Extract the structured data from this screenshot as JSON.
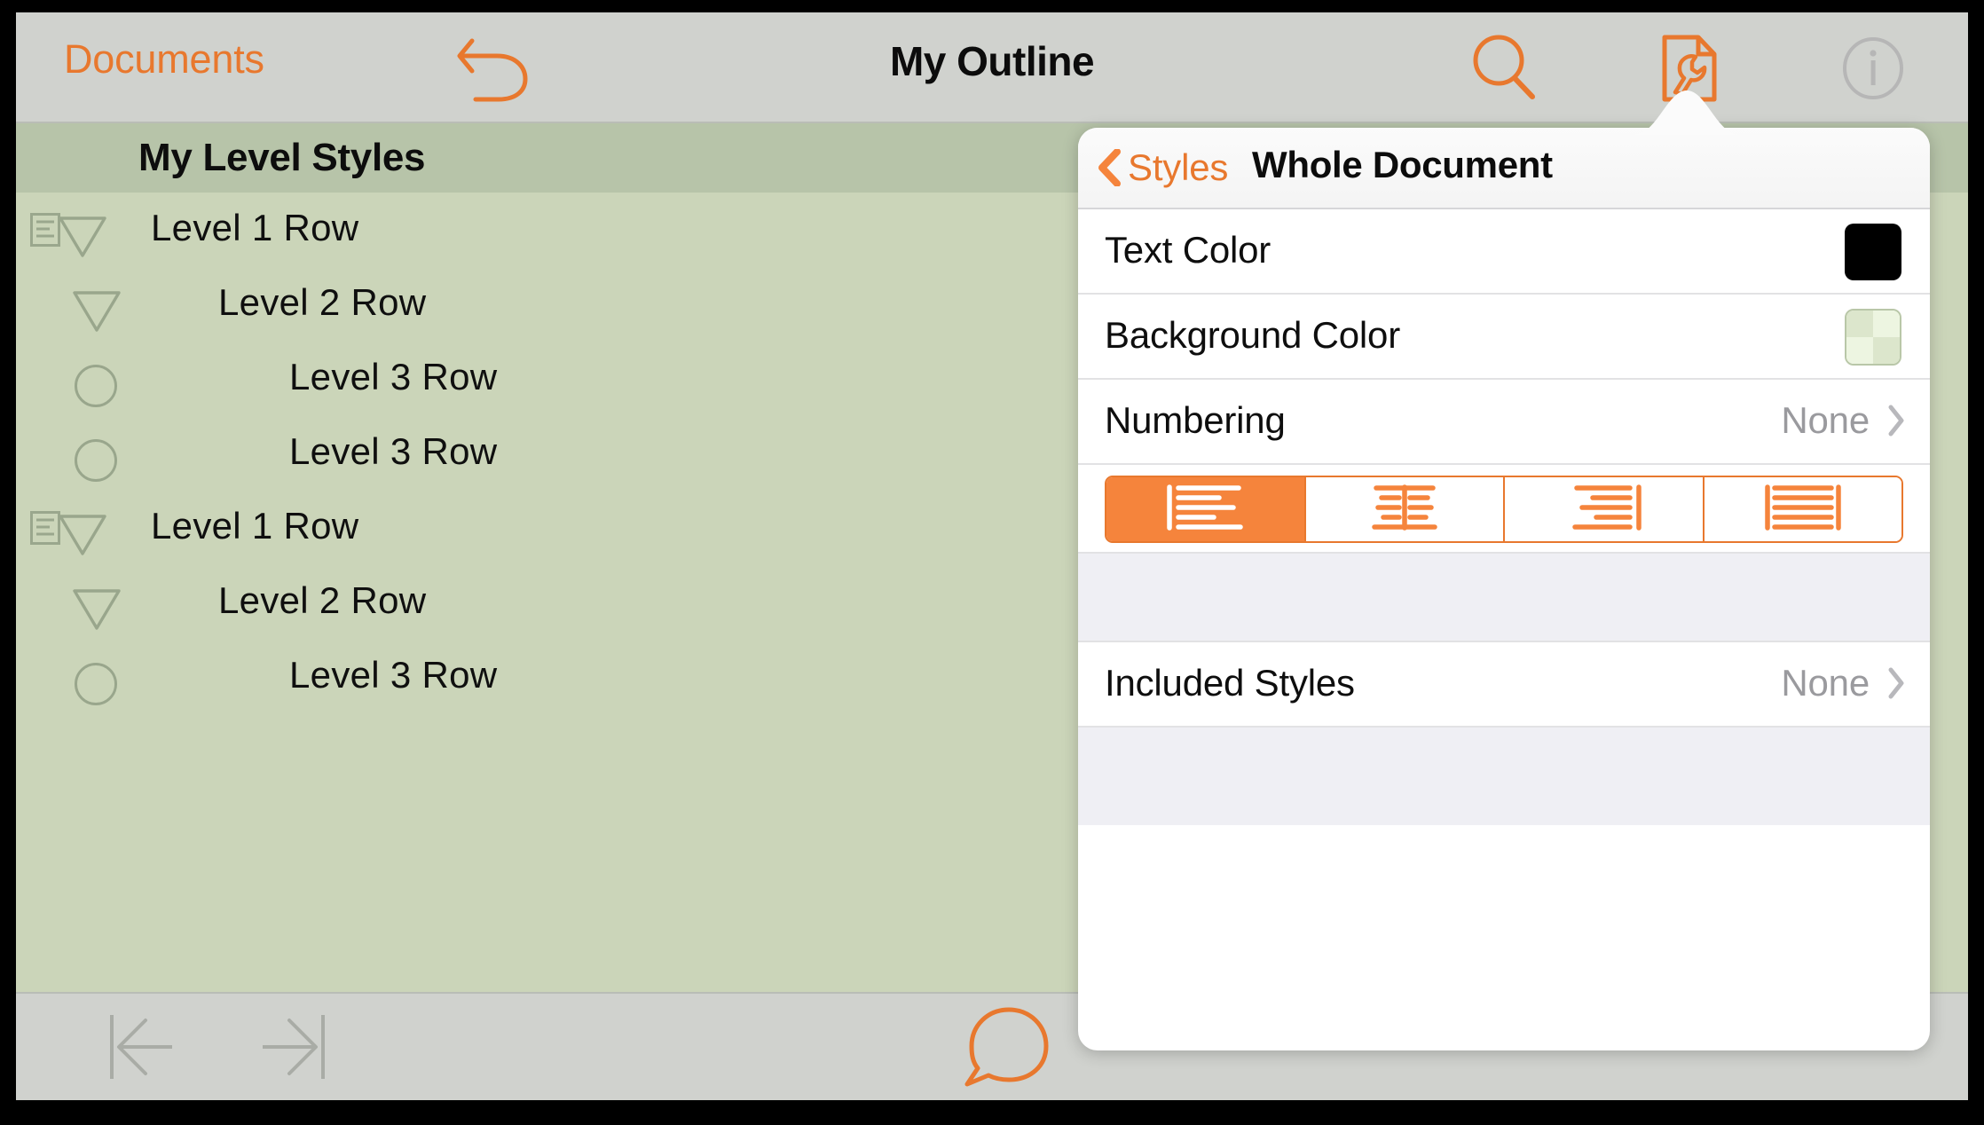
{
  "toolbar": {
    "back_label": "Documents",
    "title": "My Outline",
    "undo_icon": "undo-icon",
    "search_icon": "search-icon",
    "styles_icon": "document-wrench-icon",
    "info_icon": "info-icon",
    "outline_icon": "outline-list-icon"
  },
  "outline": {
    "header_title": "My Level Styles",
    "rows": [
      {
        "label": "Level 1 Row",
        "level": 1,
        "has_note": true,
        "marker": "triangle-down"
      },
      {
        "label": "Level 2 Row",
        "level": 2,
        "has_note": false,
        "marker": "triangle-down"
      },
      {
        "label": "Level 3 Row",
        "level": 3,
        "has_note": false,
        "marker": "circle"
      },
      {
        "label": "Level 3 Row",
        "level": 3,
        "has_note": false,
        "marker": "circle"
      },
      {
        "label": "Level 1 Row",
        "level": 1,
        "has_note": true,
        "marker": "triangle-down"
      },
      {
        "label": "Level 2 Row",
        "level": 2,
        "has_note": false,
        "marker": "triangle-down"
      },
      {
        "label": "Level 3 Row",
        "level": 3,
        "has_note": false,
        "marker": "circle"
      }
    ]
  },
  "bottombar": {
    "outdent_icon": "outdent-icon",
    "indent_icon": "indent-icon",
    "comment_icon": "comment-bubble-icon"
  },
  "popover": {
    "back_label": "Styles",
    "back_icon": "chevron-left-icon",
    "title": "Whole Document",
    "rows": [
      {
        "label": "Text Color",
        "value": "",
        "control": "color-swatch",
        "swatch": "#000000"
      },
      {
        "label": "Background Color",
        "value": "",
        "control": "color-swatch",
        "swatch": "checker-green"
      },
      {
        "label": "Numbering",
        "value": "None",
        "control": "disclosure",
        "swatch": ""
      },
      {
        "label": "Included Styles",
        "value": "None",
        "control": "disclosure",
        "swatch": ""
      }
    ],
    "alignment": {
      "options": [
        "align-left",
        "align-center",
        "align-right",
        "align-justify"
      ],
      "selected_index": 0
    }
  },
  "colors": {
    "accent": "#e8782e",
    "toolbar_gray": "#d0d2ce",
    "outline_header_green": "#b7c4a9",
    "outline_body_green": "#cbd5b9",
    "popover_group_gray": "#efeff4",
    "muted_text": "#9a9a9e"
  }
}
